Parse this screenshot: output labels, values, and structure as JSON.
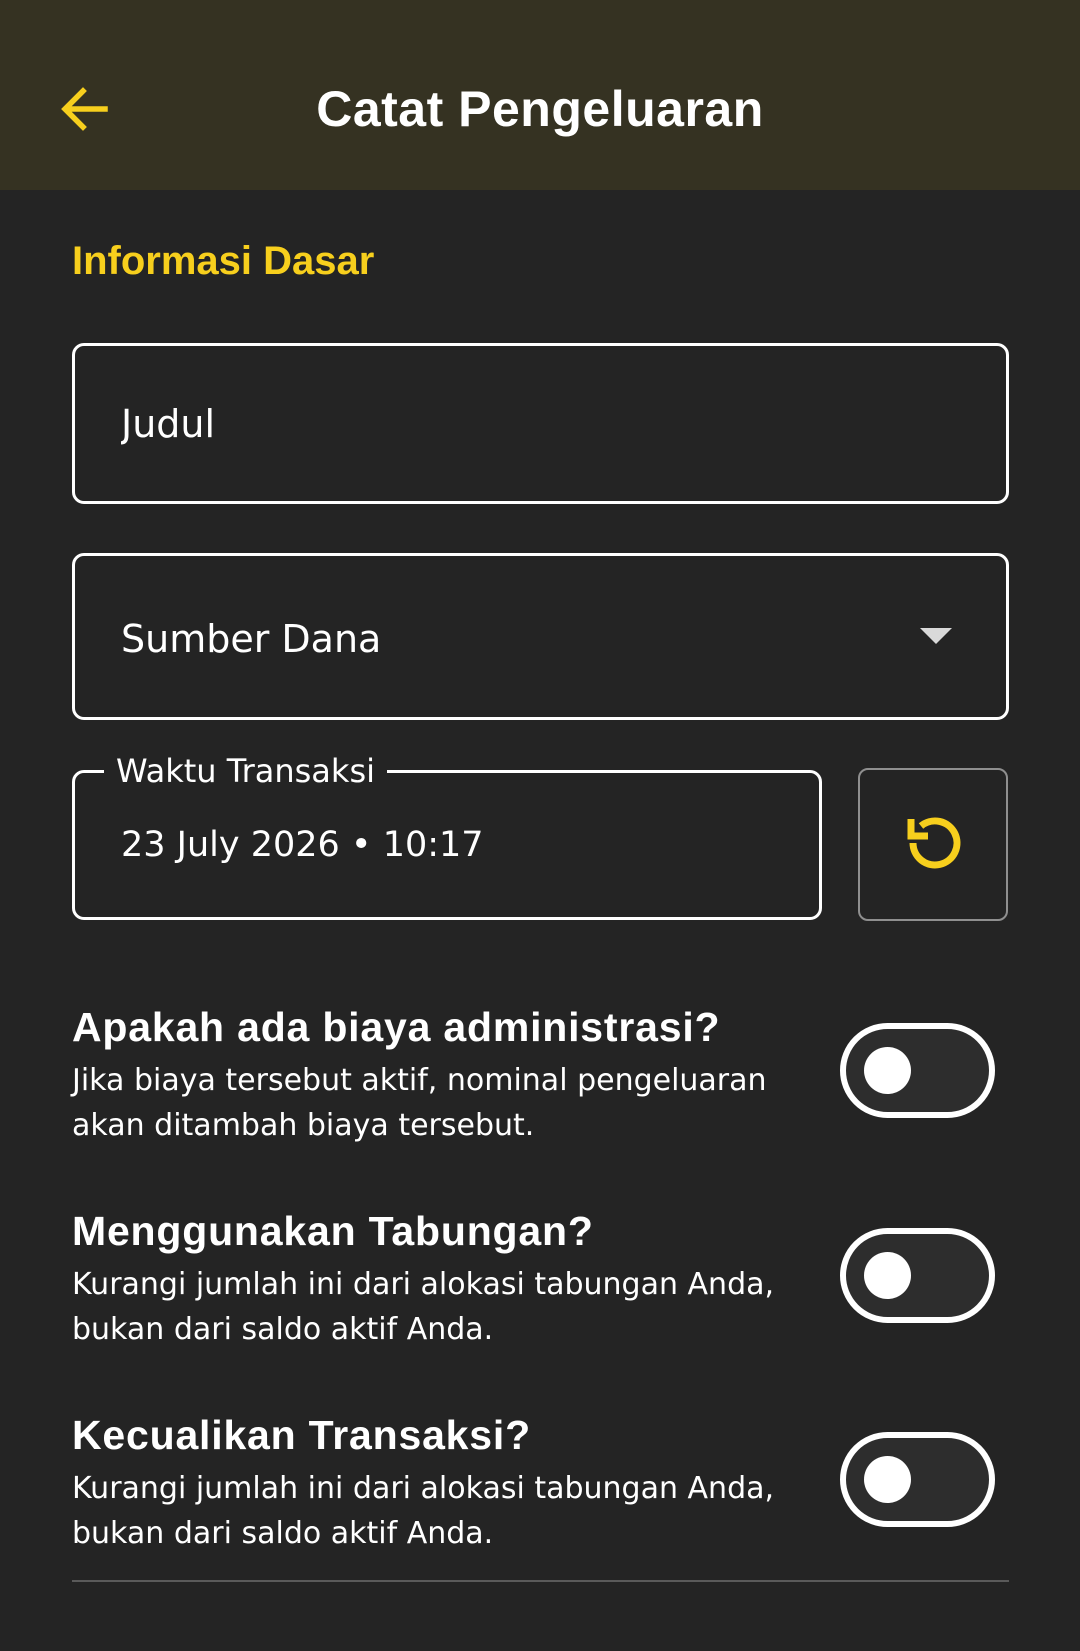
{
  "appbar": {
    "title": "Catat Pengeluaran",
    "back_icon": "arrow-left-icon"
  },
  "colors": {
    "accent": "#f7cf1d",
    "appbar_bg": "#353222",
    "page_bg": "#242424"
  },
  "section": {
    "title": "Informasi Dasar"
  },
  "form": {
    "judul_placeholder": "Judul",
    "sumber_dana": "Sumber Dana",
    "waktu_label": "Waktu Transaksi",
    "waktu_value": "23 July 2026 • 10:17",
    "reset_icon": "undo-refresh-icon"
  },
  "options": [
    {
      "title": "Apakah ada biaya administrasi?",
      "desc": "Jika biaya tersebut aktif, nominal pengeluaran akan ditambah biaya tersebut.",
      "enabled": false
    },
    {
      "title": "Menggunakan Tabungan?",
      "desc": "Kurangi jumlah ini dari alokasi tabungan Anda, bukan dari saldo aktif Anda.",
      "enabled": false
    },
    {
      "title": "Kecualikan Transaksi?",
      "desc": "Kurangi jumlah ini dari alokasi tabungan Anda, bukan dari saldo aktif Anda.",
      "enabled": false
    }
  ]
}
